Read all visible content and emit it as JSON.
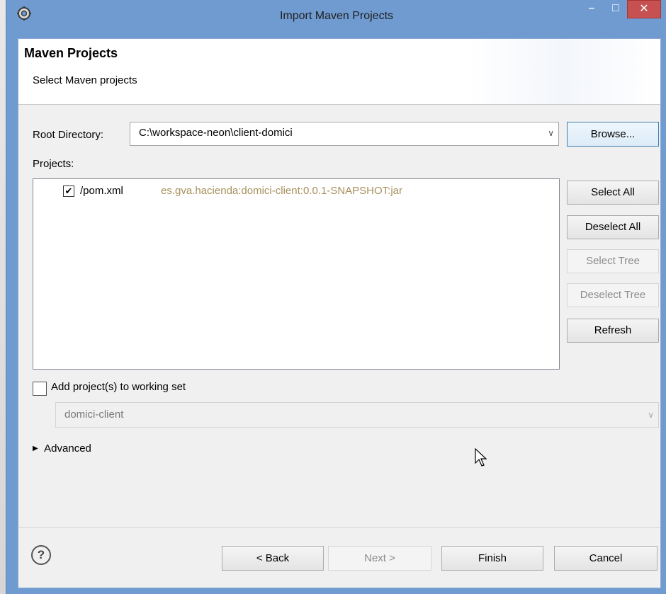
{
  "window": {
    "title": "Import Maven Projects",
    "title_icon": "eclipse-gear-icon",
    "minimize_glyph": "–",
    "maximize_glyph": "□",
    "close_glyph": "✕"
  },
  "header": {
    "title": "Maven Projects",
    "subtitle": "Select Maven projects"
  },
  "root_directory": {
    "label": "Root Directory:",
    "value": "C:\\workspace-neon\\client-domici",
    "browse_label": "Browse..."
  },
  "projects": {
    "label": "Projects:",
    "items": [
      {
        "checked": true,
        "name": "/pom.xml",
        "artifact": "es.gva.hacienda:domici-client:0.0.1-SNAPSHOT:jar"
      }
    ],
    "buttons": {
      "select_all": "Select All",
      "deselect_all": "Deselect All",
      "select_tree": "Select Tree",
      "deselect_tree": "Deselect Tree",
      "refresh": "Refresh"
    }
  },
  "working_set": {
    "checkbox_label": "Add project(s) to working set",
    "checked": false,
    "value": "domici-client"
  },
  "advanced": {
    "label": "Advanced",
    "expanded": false
  },
  "footer": {
    "help_glyph": "?",
    "back": "< Back",
    "next": "Next >",
    "finish": "Finish",
    "cancel": "Cancel"
  },
  "glyphs": {
    "dropdown": "∨",
    "checkmark": "✔",
    "expand": "▶"
  }
}
